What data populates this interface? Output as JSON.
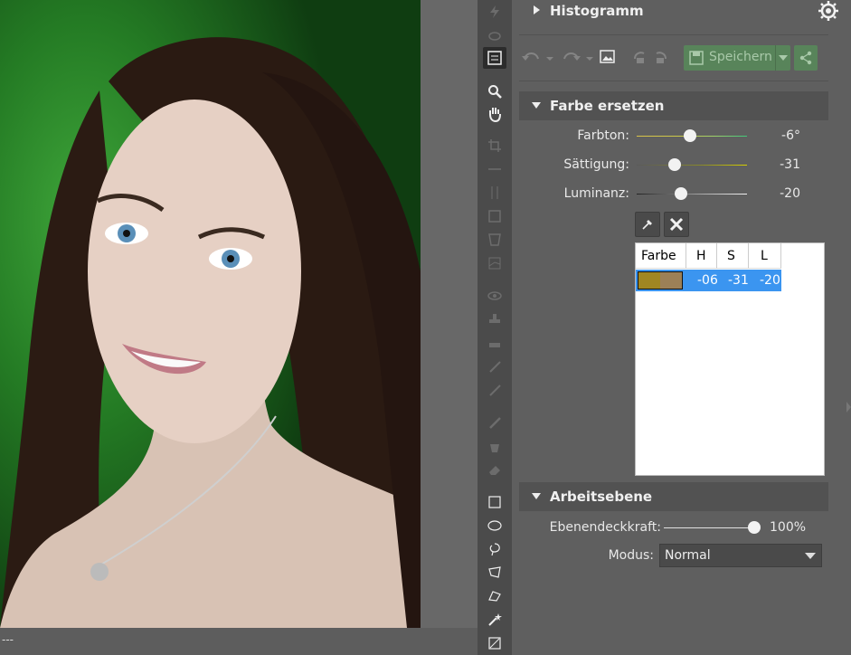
{
  "status_text": "---",
  "histogram": {
    "title": "Histogramm"
  },
  "actions": {
    "save_label": "Speichern"
  },
  "farbe_ersetzen": {
    "title": "Farbe ersetzen",
    "sliders": [
      {
        "label": "Farbton:",
        "value": "-6°",
        "level": -6,
        "min": -180,
        "max": 180
      },
      {
        "label": "Sättigung:",
        "value": "-31",
        "level": -31,
        "min": -100,
        "max": 100
      },
      {
        "label": "Luminanz:",
        "value": "-20",
        "level": -20,
        "min": -100,
        "max": 100
      }
    ],
    "table": {
      "headers": [
        "Farbe",
        "H",
        "S",
        "L"
      ],
      "rows": [
        {
          "swatch": [
            "#a08622",
            "#9c8057"
          ],
          "h": "-06",
          "s": "-31",
          "l": "-20"
        }
      ]
    }
  },
  "arbeitsebene": {
    "title": "Arbeitsebene",
    "opacity_label": "Ebenendeckkraft:",
    "opacity_value": "100%",
    "opacity_level": 100,
    "mode_label": "Modus:",
    "mode_value": "Normal"
  },
  "colors": {
    "accent_green": "#58845a",
    "selection_blue": "#3b95f0"
  }
}
